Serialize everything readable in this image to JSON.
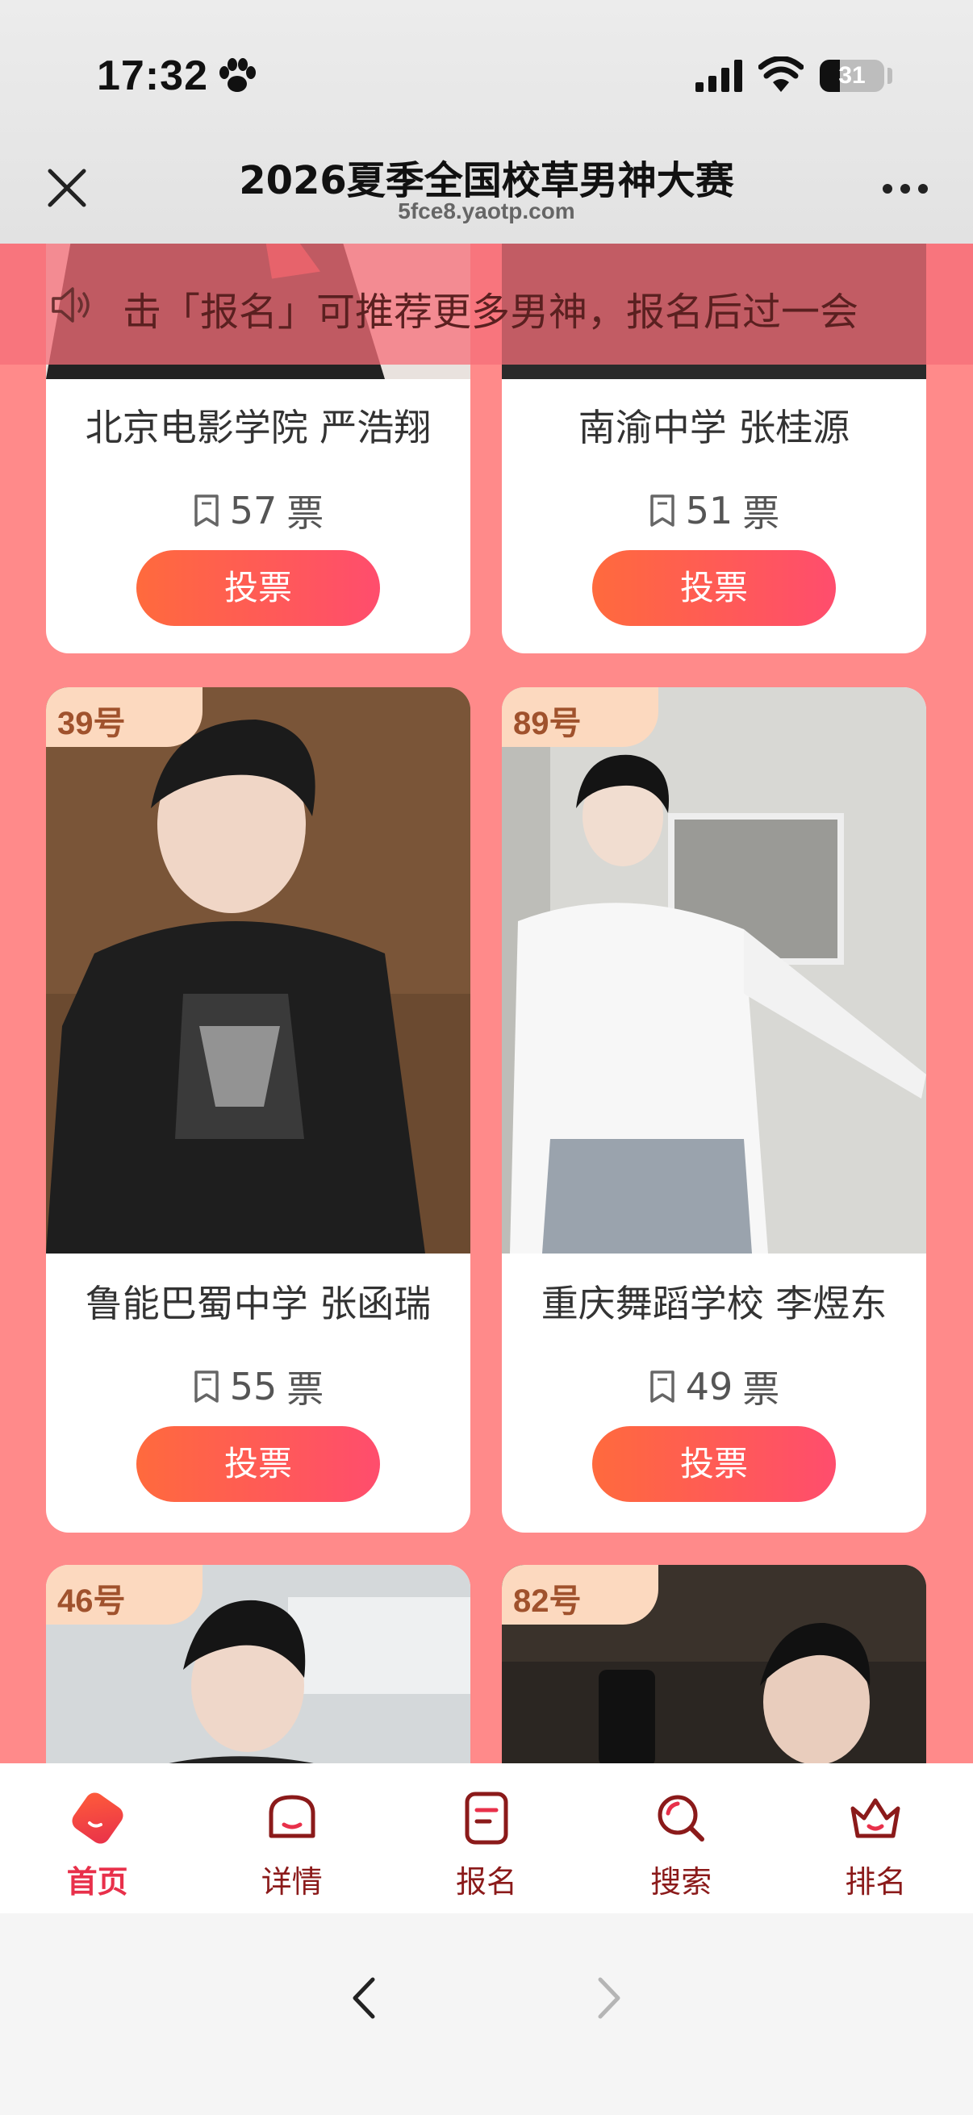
{
  "status_bar": {
    "time": "17:32",
    "battery_level": 31,
    "battery_text": "31"
  },
  "header": {
    "title": "2026夏季全国校草男神大赛",
    "url": "5fce8.yaotp.com"
  },
  "notice": {
    "text": "击「报名」可推荐更多男神，报名后过一会"
  },
  "cards": [
    {
      "id": "top-left",
      "number": "",
      "name": "北京电影学院 严浩翔",
      "votes": "57",
      "unit": "票",
      "vote_label": "投票"
    },
    {
      "id": "top-right",
      "number": "",
      "name": "南渝中学 张桂源",
      "votes": "51",
      "unit": "票",
      "vote_label": "投票"
    },
    {
      "id": "mid-left",
      "number": "39号",
      "name": "鲁能巴蜀中学 张函瑞",
      "votes": "55",
      "unit": "票",
      "vote_label": "投票"
    },
    {
      "id": "mid-right",
      "number": "89号",
      "name": "重庆舞蹈学校 李煜东",
      "votes": "49",
      "unit": "票",
      "vote_label": "投票"
    },
    {
      "id": "bot-left",
      "number": "46号"
    },
    {
      "id": "bot-right",
      "number": "82号"
    }
  ],
  "tabbar": {
    "items": [
      {
        "label": "首页",
        "icon": "home-icon",
        "active": true
      },
      {
        "label": "详情",
        "icon": "details-icon",
        "active": false
      },
      {
        "label": "报名",
        "icon": "signup-icon",
        "active": false
      },
      {
        "label": "搜索",
        "icon": "search-icon",
        "active": false
      },
      {
        "label": "排名",
        "icon": "crown-icon",
        "active": false
      }
    ]
  },
  "colors": {
    "page_bg": "#ff8a8a",
    "accent": "#e8304a",
    "button_start": "#ff6a3d",
    "button_end": "#ff4d6d",
    "badge_bg": "#fcd9bf"
  }
}
